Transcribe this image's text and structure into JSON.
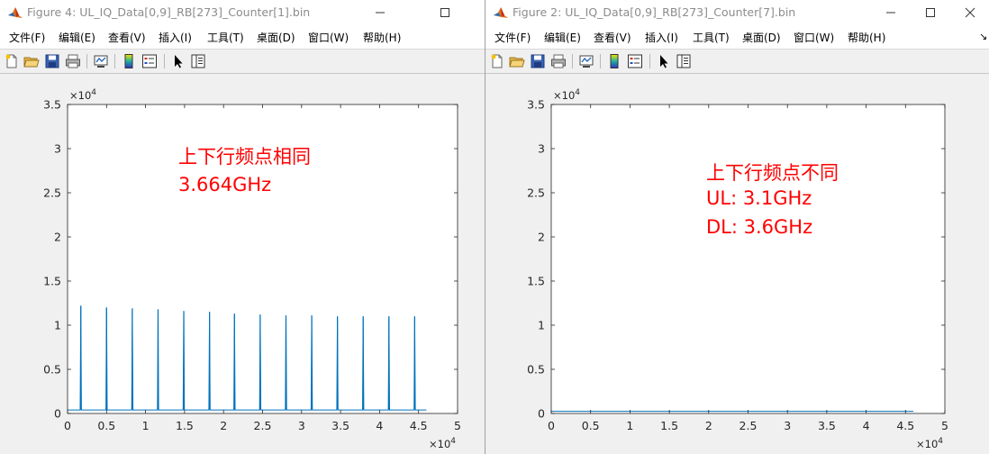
{
  "windows": [
    {
      "title": "Figure 4: UL_IQ_Data[0,9]_RB[273]_Counter[1].bin",
      "menu": [
        "文件(F)",
        "编辑(E)",
        "查看(V)",
        "插入(I)",
        "工具(T)",
        "桌面(D)",
        "窗口(W)",
        "帮助(H)"
      ],
      "annotations": [
        "上下行频点相同",
        "3.664GHz"
      ]
    },
    {
      "title": "Figure 2: UL_IQ_Data[0,9]_RB[273]_Counter[7].bin",
      "menu": [
        "文件(F)",
        "编辑(E)",
        "查看(V)",
        "插入(I)",
        "工具(T)",
        "桌面(D)",
        "窗口(W)",
        "帮助(H)"
      ],
      "annotations": [
        "上下行频点不同",
        "UL: 3.1GHz",
        "DL: 3.6GHz"
      ]
    }
  ],
  "toolbar_icons": [
    "new-figure-icon",
    "open-file-icon",
    "save-icon",
    "print-icon",
    "link-plot-icon",
    "colorbar-icon",
    "legend-icon",
    "edit-plot-arrow-icon",
    "property-inspector-icon"
  ],
  "colors": {
    "line": "#0072bd",
    "annotation": "#ff0000",
    "axes_bg": "#ffffff",
    "figure_bg": "#f0f0f0"
  },
  "chart_data": [
    {
      "type": "line",
      "title": "",
      "xlabel": "",
      "ylabel": "",
      "xlim": [
        0,
        50000
      ],
      "ylim": [
        0,
        35000
      ],
      "xticks": [
        0,
        0.5,
        1,
        1.5,
        2,
        2.5,
        3,
        3.5,
        4,
        4.5,
        5
      ],
      "yticks": [
        0,
        0.5,
        1,
        1.5,
        2,
        2.5,
        3,
        3.5
      ],
      "x_exponent": "×10",
      "x_exponent_power": "4",
      "y_exponent": "×10",
      "y_exponent_power": "4",
      "grid": false,
      "baseline": 400,
      "data_end_x": 46000,
      "spikes": {
        "x": [
          1700,
          5000,
          8300,
          11600,
          14900,
          18200,
          21400,
          24700,
          28000,
          31300,
          34600,
          37900,
          41200,
          44500
        ],
        "y": [
          12200,
          12000,
          11900,
          11800,
          11600,
          11500,
          11300,
          11200,
          11100,
          11100,
          11000,
          11000,
          11000,
          11000
        ]
      }
    },
    {
      "type": "line",
      "title": "",
      "xlabel": "",
      "ylabel": "",
      "xlim": [
        0,
        50000
      ],
      "ylim": [
        0,
        35000
      ],
      "xticks": [
        0,
        0.5,
        1,
        1.5,
        2,
        2.5,
        3,
        3.5,
        4,
        4.5,
        5
      ],
      "yticks": [
        0,
        0.5,
        1,
        1.5,
        2,
        2.5,
        3,
        3.5
      ],
      "x_exponent": "×10",
      "x_exponent_power": "4",
      "y_exponent": "×10",
      "y_exponent_power": "4",
      "grid": false,
      "baseline": 250,
      "data_end_x": 46000,
      "spikes": {
        "x": [],
        "y": []
      }
    }
  ]
}
